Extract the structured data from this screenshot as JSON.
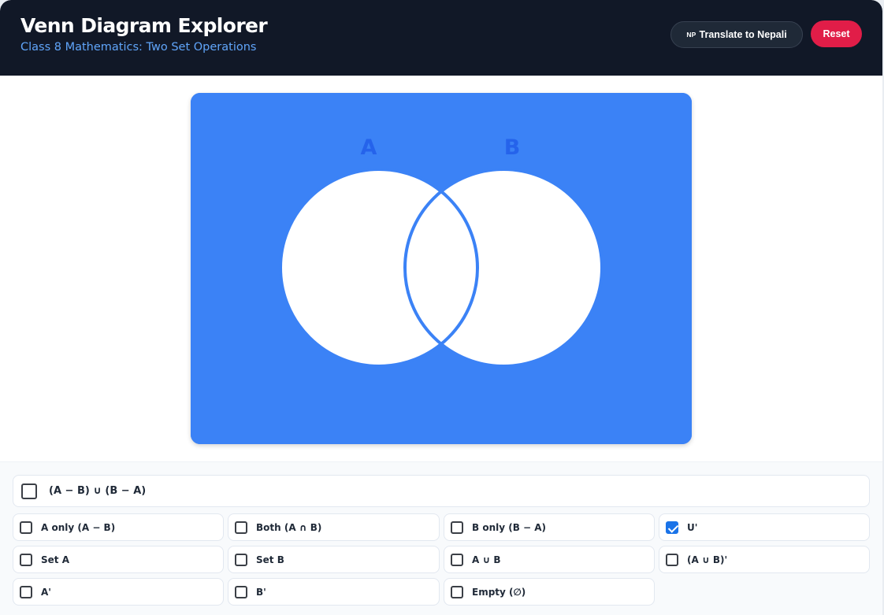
{
  "header": {
    "title": "Venn Diagram Explorer",
    "subtitle": "Class 8 Mathematics: Two Set Operations",
    "translate_badge": "NP",
    "translate_label": "Translate to Nepali",
    "reset_label": "Reset"
  },
  "venn": {
    "label_a": "A",
    "label_b": "B",
    "universe_color": "#3b82f6",
    "set_fill": "#ffffff",
    "outline_color": "#3b82f6",
    "label_color": "#2563eb"
  },
  "options": {
    "symmetric_difference": {
      "label": "(A − B) ∪ (B − A)",
      "checked": false
    },
    "a_only": {
      "label": "A only (A − B)",
      "checked": false
    },
    "both": {
      "label": "Both (A ∩ B)",
      "checked": false
    },
    "b_only": {
      "label": "B only (B − A)",
      "checked": false
    },
    "universal": {
      "label": "U'",
      "checked": true
    },
    "set_a": {
      "label": "Set A",
      "checked": false
    },
    "set_b": {
      "label": "Set B",
      "checked": false
    },
    "union": {
      "label": "A ∪ B",
      "checked": false
    },
    "union_complement": {
      "label": "(A ∪ B)'",
      "checked": false
    },
    "a_complement": {
      "label": "A'",
      "checked": false
    },
    "b_complement": {
      "label": "B'",
      "checked": false
    },
    "empty": {
      "label": "Empty (∅)",
      "checked": false
    }
  }
}
